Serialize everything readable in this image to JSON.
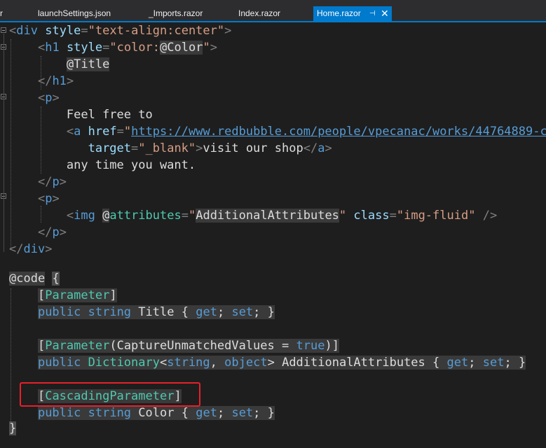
{
  "tabs": [
    {
      "label": "r"
    },
    {
      "label": "launchSettings.json"
    },
    {
      "label": "_Imports.razor"
    },
    {
      "label": "Index.razor"
    },
    {
      "label": "Home.razor",
      "active": true,
      "pin_glyph": "⊣",
      "close_glyph": "✕"
    }
  ],
  "code": {
    "l1": {
      "open": "<",
      "tag": "div",
      "attr": "style",
      "eq": "=",
      "str": "\"text-align:center\"",
      "close": ">"
    },
    "l2": {
      "open": "<",
      "tag": "h1",
      "attr": "style",
      "eq": "=",
      "str1": "\"color:",
      "at": "@",
      "var": "Color",
      "str2": "\"",
      "close": ">"
    },
    "l3": {
      "at": "@",
      "var": "Title"
    },
    "l4": {
      "open": "</",
      "tag": "h1",
      "close": ">"
    },
    "l5": {
      "open": "<",
      "tag": "p",
      "close": ">"
    },
    "l6": {
      "text": "Feel free to"
    },
    "l7": {
      "open": "<",
      "tag": "a",
      "attr": "href",
      "eq": "=",
      "q": "\"",
      "url": "https://www.redbubble.com/people/vpecanac/works/44764889-c"
    },
    "l8": {
      "attr": "target",
      "eq": "=",
      "str": "\"_blank\"",
      "close": ">",
      "text": "visit our shop",
      "open2": "</",
      "tag2": "a",
      "close2": ">"
    },
    "l9": {
      "text": "any time you want."
    },
    "l10": {
      "open": "</",
      "tag": "p",
      "close": ">"
    },
    "l11": {
      "open": "<",
      "tag": "p",
      "close": ">"
    },
    "l12": {
      "open": "<",
      "tag": "img",
      "at": "@",
      "attr_at": "attributes",
      "eq": "=",
      "q1": "\"",
      "val": "AdditionalAttributes",
      "q2": "\"",
      "attr2": "class",
      "eq2": "=",
      "str2": "\"img-fluid\"",
      "close": "/>"
    },
    "l13": {
      "open": "</",
      "tag": "p",
      "close": ">"
    },
    "l14": {
      "open": "</",
      "tag": "div",
      "close": ">"
    },
    "l15": {
      "directive": "@code",
      "brace": "{"
    },
    "l16": {
      "ob": "[",
      "attr": "Parameter",
      "cb": "]"
    },
    "l17": {
      "kw1": "public",
      "kw2": "string",
      "name": "Title",
      "ob": "{",
      "get": "get",
      "semi1": ";",
      "set": "set",
      "semi2": ";",
      "cb": "}"
    },
    "l18": {
      "ob": "[",
      "attr": "Parameter",
      "op": "(",
      "arg": "CaptureUnmatchedValues",
      "eq": "=",
      "val": "true",
      "cp": ")",
      "cb": "]"
    },
    "l19": {
      "kw1": "public",
      "type": "Dictionary",
      "lt": "<",
      "kw2": "string",
      "comma": ",",
      "kw3": "object",
      "gt": ">",
      "name": "AdditionalAttributes",
      "ob": "{",
      "get": "get",
      "semi1": ";",
      "set": "set",
      "semi2": ";",
      "cb": "}"
    },
    "l20": {
      "ob": "[",
      "attr": "CascadingParameter",
      "cb": "]"
    },
    "l21": {
      "kw1": "public",
      "kw2": "string",
      "name": "Color",
      "ob": "{",
      "get": "get",
      "semi1": ";",
      "set": "set",
      "semi2": ";",
      "cb": "}"
    },
    "l22": {
      "brace": "}"
    }
  },
  "colors": {
    "highlight_box": "#e8202a",
    "active_tab": "#007acc"
  }
}
